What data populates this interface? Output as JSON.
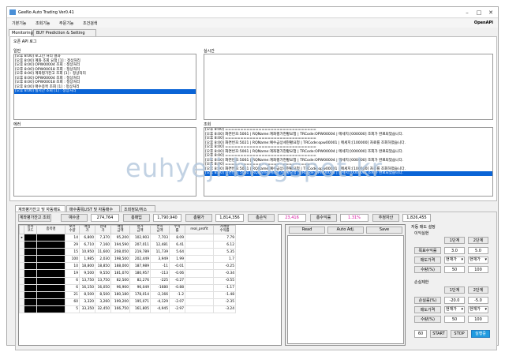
{
  "title": "GeeNo Auto Trading Ver0.41",
  "menu": [
    "기본기능",
    "조회기능",
    "주문기능",
    "조건검색"
  ],
  "openapi": "OpenAPI",
  "top_tabs": [
    "Monitoring",
    "BUY Prediction & Setting"
  ],
  "api_log": {
    "label": "오픈 API 로그",
    "general_label": "일반",
    "realtime_label": "실시간",
    "error_label": "에러",
    "query_label": "조회",
    "general": [
      "[오후 8:00] 로그인 처리 결과",
      "[오후 8:00] 계좌 조회 요청 [1] : 정상처리",
      "[오후 8:00] OPW00004 조회 : 정상처리",
      "[오후 8:00] OPW00018 조회 : 정상처리",
      "[오후 8:00] 계좌평가잔고 조회 [1] : 정상처리",
      "[오후 8:00] OPW00004 조회 : 정상처리",
      "[오후 8:00] OPW00018 조회 : 정상처리",
      "[오후 8:00] 매수종목 조회 [1] : 정상처리",
      "[오후 8:00] 실시간 조회 [1] : 정상처리"
    ],
    "query": [
      "[오후 8:00] ==============================",
      "[오후 8:00] 화면번호:5061 | RQName:계좌평가현황요청 | TRCode:OPW00004 | 메세지:[000000] 조회가 완료되었습니다.",
      "[오후 8:00] ==============================",
      "[오후 8:00] 화면번호:5021 | RQName:예수금상세현황요청 | TRCode:opw00001 | 메세지:[100000] 자료를 조회하였습니다.",
      "[오후 8:00] ==============================",
      "[오후 8:00] 화면번호:5061 | RQName:계좌평가현황요청 | TRCode:OPW00004 | 메세지:[000000] 조회가 완료되었습니다.",
      "[오후 8:00] ==============================",
      "[오후 8:00] 화면번호:5061 | RQName:계좌평가현황요청 | TRCode:OPW00004 | 메세지:[000000] 조회가 완료되었습니다.",
      "[오후 8:00] ==============================",
      "[오후 8:00] 화면번호:5021 | RQName:예수금상세현황요청 | TRCode:opw00001 | 메세지:[100000] 자료를 조회하였습니다.",
      "[오후 8:00] 화면번호:5061 | RQName:계좌평가현황요청 | TRCode:OPW00004 | 메세지:[000000] 조회가 완료되었습니다."
    ]
  },
  "watermark": "euhyeji.blogspot.kr",
  "bottom_tabs": [
    "계좌평가잔고 및 자동매도",
    "매수종목LIST 및 자동매수",
    "조회정보/취소"
  ],
  "summary": {
    "query_button": "계좌평가잔고 조회",
    "items": [
      {
        "label": "예수금",
        "value": "274,764"
      },
      {
        "label": "총매입",
        "value": "1,790,940"
      },
      {
        "label": "총평가",
        "value": "1,814,356"
      },
      {
        "label": "총손익",
        "value": "23,416"
      },
      {
        "label": "총수익률",
        "value": "1.31%"
      },
      {
        "label": "추정자산",
        "value": "1,826,455"
      }
    ]
  },
  "table": {
    "headers": [
      "종목\n코드",
      "종목명",
      "보유\n수량",
      "매입\n가",
      "현재\n가",
      "매입\n금액",
      "평가\n금액",
      "손익\n금액",
      "수익\n률",
      "real_profit",
      "거래량\n수익률"
    ],
    "rows": [
      [
        "14",
        "6,800",
        "7,370",
        "95,200",
        "102,903",
        "7,703",
        "8.09",
        "7.79"
      ],
      [
        "29",
        "6,710",
        "7,160",
        "194,590",
        "207,011",
        "12,481",
        "6.41",
        "6.12"
      ],
      [
        "15",
        "10,950",
        "11,600",
        "208,050",
        "219,789",
        "11,739",
        "5.64",
        "5.35"
      ],
      [
        "100",
        "1,985",
        "2,030",
        "198,500",
        "202,449",
        "3,949",
        "1.99",
        "1.7"
      ],
      [
        "10",
        "18,800",
        "18,850",
        "188,000",
        "187,989",
        "-11",
        "-0.01",
        "-0.25"
      ],
      [
        "19",
        "9,500",
        "9,550",
        "181,070",
        "180,957",
        "-113",
        "-0.06",
        "-0.34"
      ],
      [
        "6",
        "13,750",
        "13,750",
        "82,500",
        "82,276",
        "-225",
        "-0.27",
        "-0.55"
      ],
      [
        "6",
        "16,150",
        "16,050",
        "96,900",
        "96,049",
        "-1680",
        "-0.88",
        "-1.17"
      ],
      [
        "21",
        "8,500",
        "8,500",
        "180,180",
        "178,014",
        "-2,166",
        "-1.2",
        "-1.48"
      ],
      [
        "60",
        "3,320",
        "3,260",
        "199,200",
        "195,071",
        "-4,129",
        "-2.07",
        "-2.35"
      ],
      [
        "5",
        "33,350",
        "32,450",
        "166,750",
        "161,805",
        "-4,945",
        "-2.97",
        "-3.24"
      ]
    ]
  },
  "actions": {
    "read": "Read",
    "auto_adj": "Auto Adj.",
    "save": "Save"
  },
  "auto_sell": {
    "title": "자동 매도 설정",
    "profit_label": "이익실현",
    "loss_label": "손실제한",
    "first": "1단계",
    "second": "2단계",
    "target_rate_label": "목표수익률",
    "sell_price_label": "매도가격",
    "qty_label": "수량(%)",
    "loss_rate_label": "손실률(%)",
    "profit_first_rate": "3.0",
    "profit_second_rate": "5.0",
    "price_option": "현재가",
    "profit_first_qty": "50",
    "profit_second_qty": "100",
    "loss_first_rate": "-20.0",
    "loss_second_rate": "-5.0",
    "loss_first_qty": "50",
    "loss_second_qty": "100",
    "interval": "60",
    "start": "START",
    "stop": "STOP",
    "run": "실행중"
  }
}
